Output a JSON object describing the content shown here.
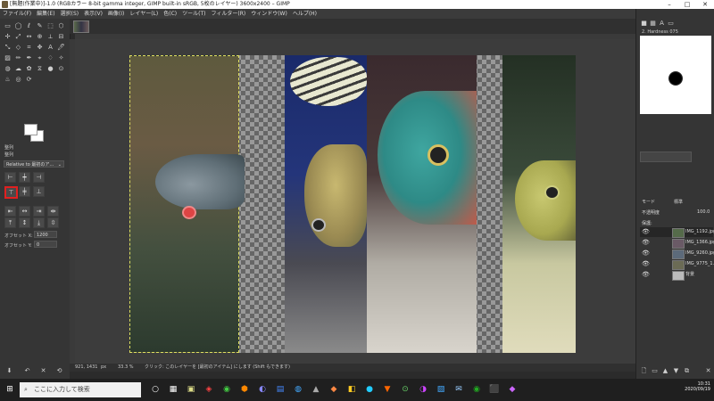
{
  "window": {
    "title": "[無題(作業中)]-1.0 (RGBカラー 8-bit gamma integer, GIMP built-in sRGB, 5枚のレイヤー) 3600x2400 – GIMP"
  },
  "menubar": {
    "items": [
      "ファイル(F)",
      "編集(E)",
      "選択(S)",
      "表示(V)",
      "画像(I)",
      "レイヤー(L)",
      "色(C)",
      "ツール(T)",
      "フィルター(R)",
      "ウィンドウ(W)",
      "ヘルプ(H)"
    ]
  },
  "tool_options": {
    "title": "整列",
    "relative_label": "整列",
    "relative_to": "Relative to 最初のア…",
    "offset_x_label": "オフセット X:",
    "offset_x_value": "1200",
    "offset_y_label": "オフセット Y:",
    "offset_y_value": "0"
  },
  "brushes": {
    "name": "2. Hardness 075"
  },
  "layers": {
    "mode_label": "モード",
    "mode_value": "標準",
    "opacity_label": "不透明度",
    "opacity_value": "100.0",
    "lock_label": "保護:",
    "items": [
      {
        "name": "IMG_1192.jpg",
        "thumb": "#556b4a"
      },
      {
        "name": "IMG_1366.jpg",
        "thumb": "#6a5a66"
      },
      {
        "name": "IMG_9260.jpg",
        "thumb": "#5c6a7a"
      },
      {
        "name": "IMG_9775_1.j",
        "thumb": "#6b6b55"
      },
      {
        "name": "背景",
        "thumb": "#bbbbbb"
      }
    ]
  },
  "statusbar": {
    "coords": "921, 1431",
    "unit": "px",
    "zoom": "33.3 %",
    "message": "クリック: このレイヤーを [最初のアイテム] にします (Shift もできます)"
  },
  "taskbar": {
    "search_placeholder": "ここに入力して検索",
    "time": "10:31",
    "date": "2020/09/19"
  }
}
